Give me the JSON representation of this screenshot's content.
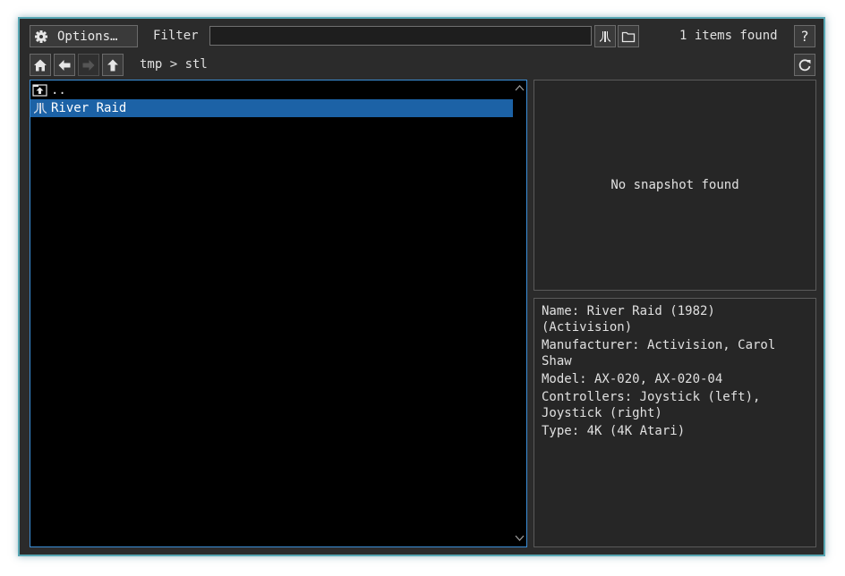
{
  "toolbar": {
    "options_label": "Options…",
    "filter_label": "Filter",
    "filter_value": "",
    "items_found": "1 items found",
    "help_label": "?"
  },
  "nav": {
    "path": "tmp > stl"
  },
  "list": {
    "items": [
      {
        "label": "..",
        "icon": "parent-folder-icon"
      },
      {
        "label": "River Raid",
        "icon": "atari-logo-icon",
        "selected": true
      }
    ]
  },
  "snapshot": {
    "message": "No snapshot found"
  },
  "info": {
    "lines": [
      "Name: River Raid (1982)",
      "(Activision)",
      "Manufacturer: Activision, Carol",
      "Shaw",
      "Model: AX-020, AX-020-04",
      "Controllers: Joystick (left),",
      "Joystick (right)",
      "Type: 4K (4K Atari)"
    ]
  },
  "colors": {
    "window_border": "#57a6b3",
    "selection": "#1c62a6",
    "list_border": "#3c8fd8"
  }
}
